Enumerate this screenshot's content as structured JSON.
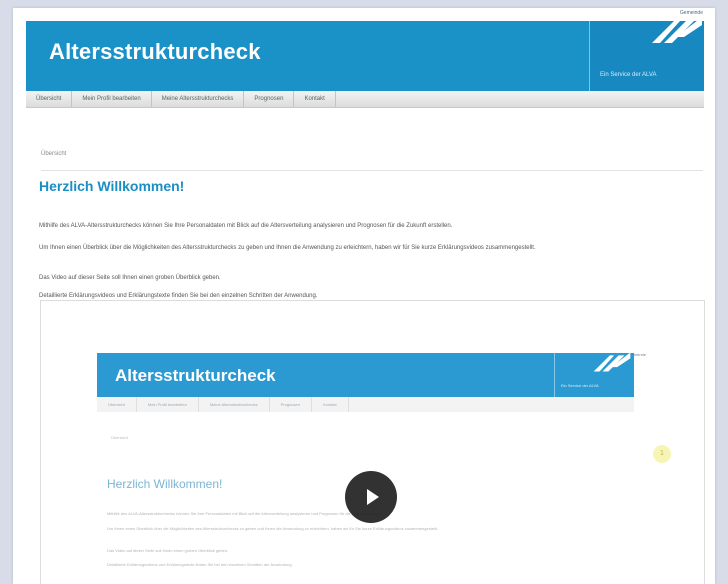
{
  "brand": {
    "small_label": "Gemeinde",
    "tagline": "Ein Service der ALVA"
  },
  "header": {
    "title": "Altersstrukturcheck"
  },
  "nav": {
    "items": [
      {
        "label": "Übersicht"
      },
      {
        "label": "Mein Profil bearbeiten"
      },
      {
        "label": "Meine Altersstrukturchecks"
      },
      {
        "label": "Prognosen"
      },
      {
        "label": "Kontakt"
      }
    ]
  },
  "breadcrumb": "Übersicht",
  "content": {
    "heading": "Herzlich Willkommen!",
    "paragraphs": [
      "Mithilfe des ALVA-Altersstrukturchecks können Sie Ihre Personaldaten mit Blick auf die Altersverteilung analysieren und Prognosen für die Zukunft erstellen.",
      "Um Ihnen einen Überblick über die Möglichkeiten des Altersstrukturchecks zu geben und Ihnen die Anwendung zu erleichtern, haben wir für Sie kurze Erklärungsvideos zusammengestellt.",
      "Das Video auf dieser Seite soll Ihnen einen groben Überblick geben.",
      "Detaillierte Erklärungsvideos und Erklärungstexte finden Sie bei den einzelnen Schritten der Anwendung."
    ]
  },
  "video": {
    "brand_small": "Gemeinde",
    "tagline": "Ein Service der ALVA",
    "title": "Altersstrukturcheck",
    "nav": [
      "Übersicht",
      "Mein Profil bearbeiten",
      "Meine Altersstrukturchecks",
      "Prognosen",
      "Kontakt"
    ],
    "breadcrumb": "Übersicht",
    "heading": "Herzlich Willkommen!",
    "paragraphs": [
      "Mithilfe des ALVA-Altersstrukturchecks können Sie Ihre Personaldaten mit Blick auf die Altersverteilung analysieren und Prognosen für die Zukunft erstellen.",
      "Um Ihnen einen Überblick über die Möglichkeiten des Altersstrukturchecks zu geben und Ihnen die Anwendung zu erleichtern, haben wir für Sie kurze Erklärungsvideos zusammengestellt.",
      "Das Video auf dieser Seite soll Ihnen einen groben Überblick geben.",
      "Detaillierte Erklärungsvideos und Erklärungstexte finden Sie bei den einzelnen Schritten der Anwendung."
    ],
    "badge": "1"
  },
  "colors": {
    "brand_blue": "#1a92c8",
    "heading_blue": "#1a8fc4",
    "play_bg": "#1c1c1c"
  },
  "icons": {
    "logo": "alva-logo-icon",
    "play": "play-icon"
  }
}
